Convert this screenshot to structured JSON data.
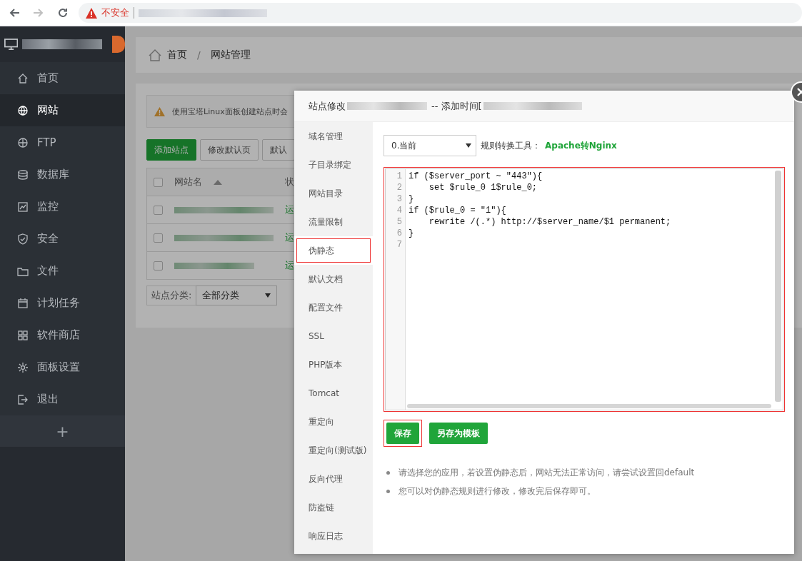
{
  "browser": {
    "nav": [
      {
        "kind": "back",
        "disabled": false
      },
      {
        "kind": "forward",
        "disabled": true
      },
      {
        "kind": "reload",
        "disabled": false
      }
    ],
    "security_label": "不安全"
  },
  "sidebar": {
    "items": [
      {
        "label": "首页",
        "selected": false
      },
      {
        "label": "网站",
        "selected": true
      },
      {
        "label": "FTP",
        "selected": false
      },
      {
        "label": "数据库",
        "selected": false
      },
      {
        "label": "监控",
        "selected": false
      },
      {
        "label": "安全",
        "selected": false
      },
      {
        "label": "文件",
        "selected": false
      },
      {
        "label": "计划任务",
        "selected": false
      },
      {
        "label": "软件商店",
        "selected": false
      },
      {
        "label": "面板设置",
        "selected": false
      },
      {
        "label": "退出",
        "selected": false
      }
    ],
    "add_label": "+"
  },
  "breadcrumb": {
    "items": [
      "首页",
      "网站管理"
    ],
    "separator": "/"
  },
  "sites": {
    "notice": "使用宝塔Linux面板创建站点时会",
    "buttons": [
      {
        "label": "添加站点",
        "kind": "primary"
      },
      {
        "label": "修改默认页",
        "kind": "default"
      },
      {
        "label": "默认",
        "kind": "default"
      }
    ],
    "table": {
      "header_checked": false,
      "columns": [
        "网站名",
        "状"
      ],
      "rows": [
        {
          "checked": false,
          "status": "运"
        },
        {
          "checked": false,
          "status": "运"
        },
        {
          "checked": false,
          "status": "运"
        }
      ]
    },
    "filter": {
      "label": "站点分类:",
      "value": "全部分类"
    }
  },
  "modal": {
    "title": "站点修改",
    "added_label": "-- 添加时间[",
    "tabs": [
      {
        "label": "域名管理",
        "selected": false,
        "highlighted": false
      },
      {
        "label": "子目录绑定",
        "selected": false,
        "highlighted": false
      },
      {
        "label": "网站目录",
        "selected": false,
        "highlighted": false
      },
      {
        "label": "流量限制",
        "selected": false,
        "highlighted": false
      },
      {
        "label": "伪静态",
        "selected": true,
        "highlighted": true
      },
      {
        "label": "默认文档",
        "selected": false,
        "highlighted": false
      },
      {
        "label": "配置文件",
        "selected": false,
        "highlighted": false
      },
      {
        "label": "SSL",
        "selected": false,
        "highlighted": false
      },
      {
        "label": "PHP版本",
        "selected": false,
        "highlighted": false
      },
      {
        "label": "Tomcat",
        "selected": false,
        "highlighted": false
      },
      {
        "label": "重定向",
        "selected": false,
        "highlighted": false
      },
      {
        "label": "重定向(测试版)",
        "selected": false,
        "highlighted": false
      },
      {
        "label": "反向代理",
        "selected": false,
        "highlighted": false
      },
      {
        "label": "防盗链",
        "selected": false,
        "highlighted": false
      },
      {
        "label": "响应日志",
        "selected": false,
        "highlighted": false
      }
    ],
    "rule_select": "0.当前",
    "converter_label": "规则转换工具：",
    "converter_link": "Apache转Nginx",
    "editor": {
      "highlighted": true,
      "lines": [
        {
          "number": "1",
          "text": "if ($server_port ~ \"443\"){"
        },
        {
          "number": "2",
          "text": "    set $rule_0 1$rule_0;"
        },
        {
          "number": "3",
          "text": "}"
        },
        {
          "number": "4",
          "text": "if ($rule_0 = \"1\"){"
        },
        {
          "number": "5",
          "text": "    rewrite /(.*) http://$server_name/$1 permanent;"
        },
        {
          "number": "6",
          "text": "}"
        },
        {
          "number": "7"
        }
      ]
    },
    "buttons": [
      {
        "label": "保存",
        "highlighted": true
      },
      {
        "label": "另存为模板",
        "highlighted": false
      }
    ],
    "hints": [
      "请选择您的应用，若设置伪静态后，网站无法正常访问，请尝试设置回default",
      "您可以对伪静态规则进行修改，修改完后保存即可。"
    ]
  }
}
